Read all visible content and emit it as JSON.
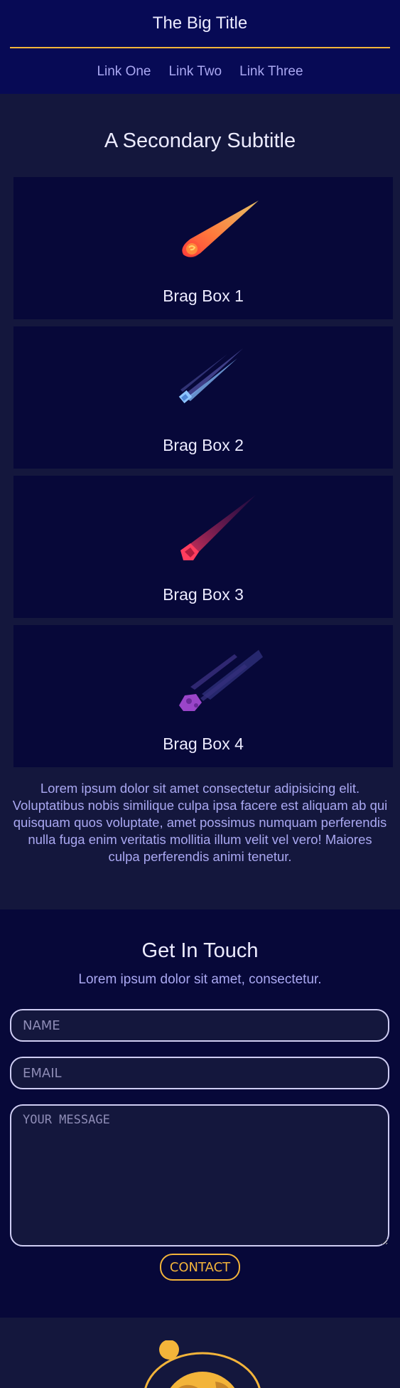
{
  "header": {
    "title": "The Big Title",
    "nav": [
      "Link One",
      "Link Two",
      "Link Three"
    ],
    "accent_color": "#f3b43a"
  },
  "main": {
    "subtitle": "A Secondary Subtitle",
    "boxes": [
      {
        "label": "Brag Box 1",
        "icon": "fiery-meteor-icon"
      },
      {
        "label": "Brag Box 2",
        "icon": "blue-comet-icon"
      },
      {
        "label": "Brag Box 3",
        "icon": "red-meteor-icon"
      },
      {
        "label": "Brag Box 4",
        "icon": "purple-asteroid-icon"
      }
    ],
    "lorem": "Lorem ipsum dolor sit amet consectetur adipisicing elit. Voluptatibus nobis similique culpa ipsa facere est aliquam ab qui quisquam quos voluptate, amet possimus numquam perferendis nulla fuga enim veritatis mollitia illum velit vel vero! Maiores culpa perferendis animi tenetur."
  },
  "contact": {
    "title": "Get In Touch",
    "subtitle": "Lorem ipsum dolor sit amet, consectetur.",
    "name_placeholder": "NAME",
    "email_placeholder": "EMAIL",
    "message_placeholder": "YOUR MESSAGE",
    "button_label": "CONTACT"
  },
  "footer": {
    "icon": "orbiting-planet-icon"
  }
}
